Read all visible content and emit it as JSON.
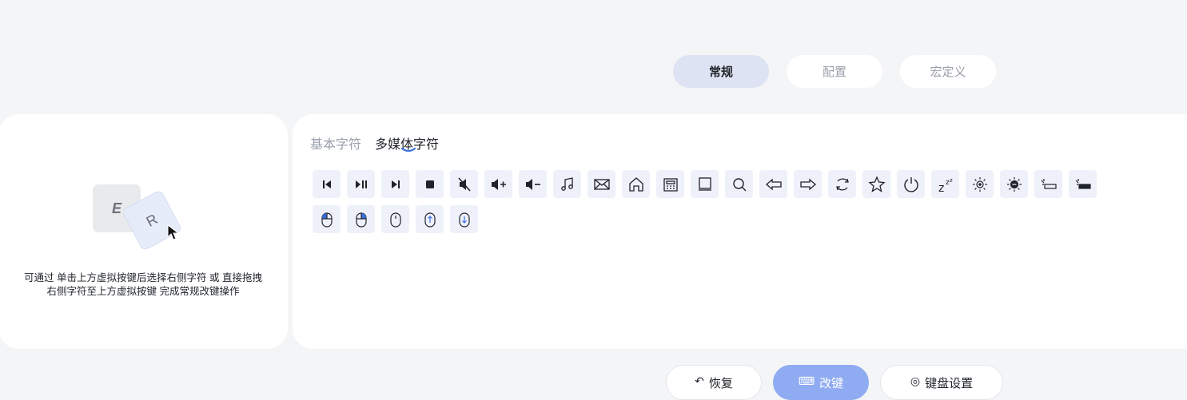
{
  "mode_tabs": [
    {
      "label": "常规",
      "active": true
    },
    {
      "label": "配置",
      "active": false
    },
    {
      "label": "宏定义",
      "active": false
    }
  ],
  "hint": {
    "key_e": "E",
    "key_r": "R",
    "line1": "可通过 单击上方虚拟按键后选择右侧字符 或 直接拖拽",
    "line2": "右侧字符至上方虚拟按键 完成常规改键操作"
  },
  "char_tabs": [
    {
      "label": "基本字符",
      "active": false
    },
    {
      "label": "多媒体字符",
      "active": true
    }
  ],
  "media_icons": [
    "previous-track-icon",
    "play-pause-icon",
    "next-track-icon",
    "stop-icon",
    "mute-icon",
    "volume-up-icon",
    "volume-down-icon",
    "music-icon",
    "mail-icon",
    "home-icon",
    "calculator-icon",
    "my-computer-icon",
    "search-icon",
    "back-arrow-icon",
    "forward-arrow-icon",
    "refresh-icon",
    "favorites-icon",
    "power-icon",
    "sleep-icon",
    "brightness-up-icon",
    "brightness-down-icon",
    "backlight-down-icon",
    "backlight-up-icon",
    "mouse-left-click-icon",
    "mouse-right-click-icon",
    "mouse-middle-click-icon",
    "mouse-scroll-up-icon",
    "mouse-scroll-down-icon"
  ],
  "bottom_buttons": [
    {
      "label": "恢复",
      "icon": "undo-icon"
    },
    {
      "label": "改键",
      "icon": "remap-icon",
      "primary": true
    },
    {
      "label": "键盘设置",
      "icon": "settings-icon"
    }
  ],
  "colors": {
    "accent": "#8fabf2",
    "active_tab_bg": "#dde3f2",
    "icon_bg": "#eef1f9"
  }
}
